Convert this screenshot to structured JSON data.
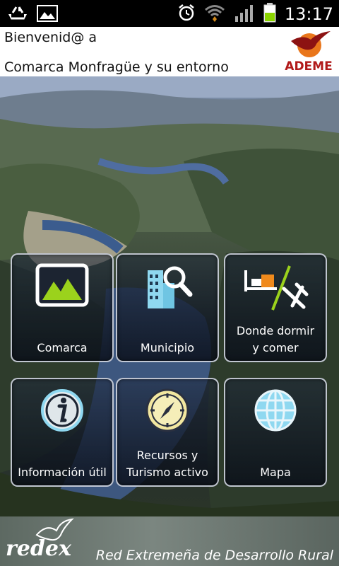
{
  "status_bar": {
    "time": "13:17",
    "icons": [
      "recycle-icon",
      "image-icon",
      "alarm-icon",
      "wifi-icon",
      "signal-icon",
      "battery-icon"
    ]
  },
  "header": {
    "greeting": "Bienvenid@ a",
    "region": "Comarca Monfragüe y su entorno",
    "logo_text": "ADEME"
  },
  "tiles": [
    {
      "label": "Comarca",
      "icon": "landscape-picture-icon"
    },
    {
      "label": "Municipio",
      "icon": "building-search-icon"
    },
    {
      "label_line1": "Donde dormir",
      "label_line2": "y comer",
      "icon": "bed-cutlery-icon"
    },
    {
      "label": "Información útil",
      "icon": "info-icon"
    },
    {
      "label_line1": "Recursos y",
      "label_line2": "Turismo activo",
      "icon": "compass-icon"
    },
    {
      "label": "Mapa",
      "icon": "globe-icon"
    }
  ],
  "footer": {
    "brand": "redex",
    "tagline": "Red Extremeña de Desarrollo Rural"
  },
  "colors": {
    "accent_red": "#b11a1a",
    "status_bg": "#000000",
    "battery_green": "#8bd400"
  }
}
